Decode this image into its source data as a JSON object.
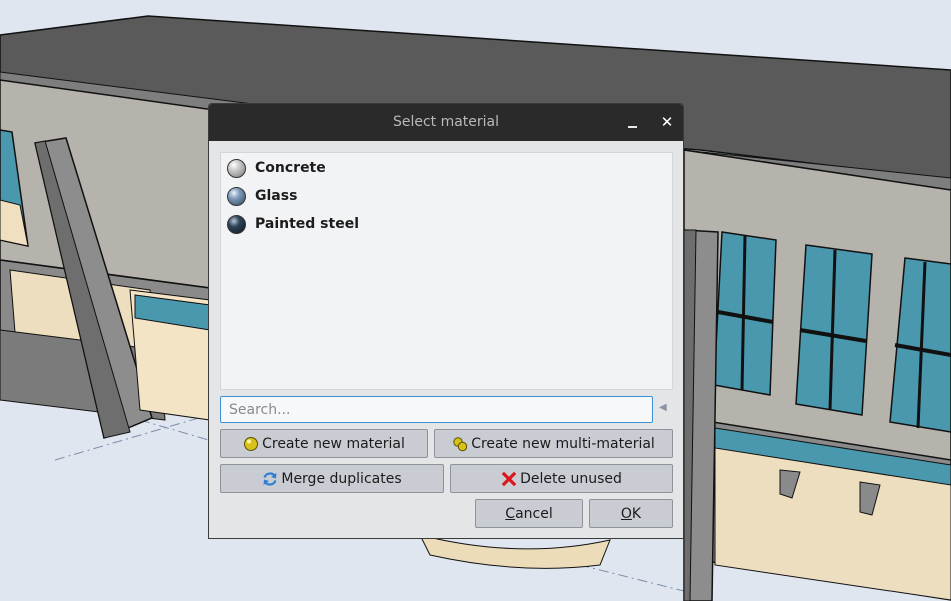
{
  "dialog": {
    "title": "Select material",
    "minimize_icon": "minimize-icon",
    "close_icon": "close-icon"
  },
  "materials": [
    {
      "label": "Concrete",
      "icon": "sphere-icon",
      "color": "#b5b5b5"
    },
    {
      "label": "Glass",
      "icon": "sphere-icon",
      "color": "#6d8aa8"
    },
    {
      "label": "Painted steel",
      "icon": "sphere-icon",
      "color": "#26384a"
    }
  ],
  "search": {
    "placeholder": "Search...",
    "value": "",
    "clear_icon": "clear-icon"
  },
  "buttons": {
    "create_new": "Create new material",
    "create_multi": "Create new multi-material",
    "merge": "Merge duplicates",
    "delete_unused": "Delete unused",
    "cancel_mnemonic": "C",
    "cancel_rest": "ancel",
    "ok_mnemonic": "O",
    "ok_rest": "K"
  },
  "colors": {
    "accent": "#3d8fd6",
    "titlebar": "#2a2a2a",
    "dialog_bg": "#e4e5e7"
  }
}
